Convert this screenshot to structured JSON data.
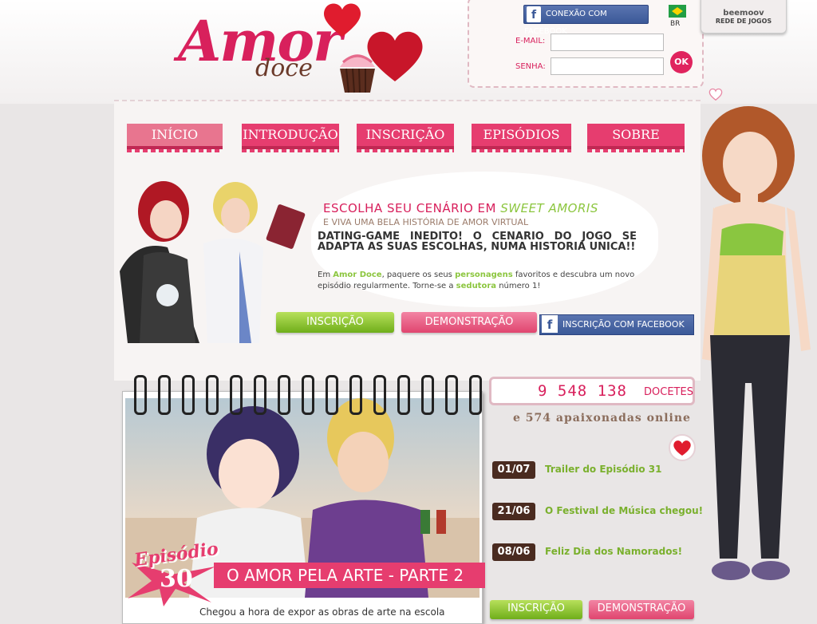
{
  "logo": {
    "amor": "Amor",
    "doce": "doce"
  },
  "login": {
    "facebook_button": "CONEXÃO COM FACEBOOK",
    "language": "BR",
    "email_label": "E-MAIL:",
    "password_label": "SENHA:",
    "ok_label": "OK"
  },
  "network": {
    "brand": "beemoov",
    "label": "REDE DE JOGOS"
  },
  "nav": {
    "tabs": [
      {
        "label": "INÍCIO"
      },
      {
        "label": "INTRODUÇÃO"
      },
      {
        "label": "INSCRIÇÃO"
      },
      {
        "label": "EPISÓDIOS"
      },
      {
        "label": "SOBRE"
      }
    ]
  },
  "hero": {
    "title_main": "ESCOLHA SEU CENÁRIO EM ",
    "title_em": "SWEET AMORIS",
    "subtitle": "E VIVA UMA BELA HISTÓRIA DE AMOR VIRTUAL",
    "bold_text": "DATING-GAME INEDITO! O CENARIO DO JOGO SE ADAPTA AS SUAS ESCOLHAS, NUMA HISTORIA UNICA!!",
    "text_part1": "Em ",
    "text_game": "Amor Doce",
    "text_part2": ", paquere os seus ",
    "text_personagens": "personagens",
    "text_part3": " favoritos e descubra um novo episódio regularmente. Torne-se a ",
    "text_sedutora": "sedutora",
    "text_part4": " número 1!",
    "signup_button": "INSCRIÇÃO",
    "demo_button": "DEMONSTRAÇÃO",
    "facebook_signup_button": "INSCRIÇÃO COM FACEBOOK"
  },
  "episode": {
    "word": "Episódio",
    "number": "30",
    "title": "O AMOR PELA ARTE - PARTE 2",
    "desc": "Chegou a hora de expor as obras de arte na escola"
  },
  "stats": {
    "count": "9 548 138",
    "count_label": "DOCETES",
    "online": "e 574 apaixonadas online"
  },
  "news": [
    {
      "date": "01/07",
      "title": "Trailer do Episódio 31"
    },
    {
      "date": "21/06",
      "title": "O Festival de Música chegou!"
    },
    {
      "date": "08/06",
      "title": "Feliz Dia dos Namorados!"
    }
  ],
  "bottom_buttons": {
    "signup": "INSCRIÇÃO",
    "demo": "DEMONSTRAÇÃO"
  },
  "colors": {
    "brand_pink": "#e63d6f",
    "brand_green": "#8cc63f",
    "facebook": "#3b5998",
    "date_brown": "#4a2b20"
  }
}
